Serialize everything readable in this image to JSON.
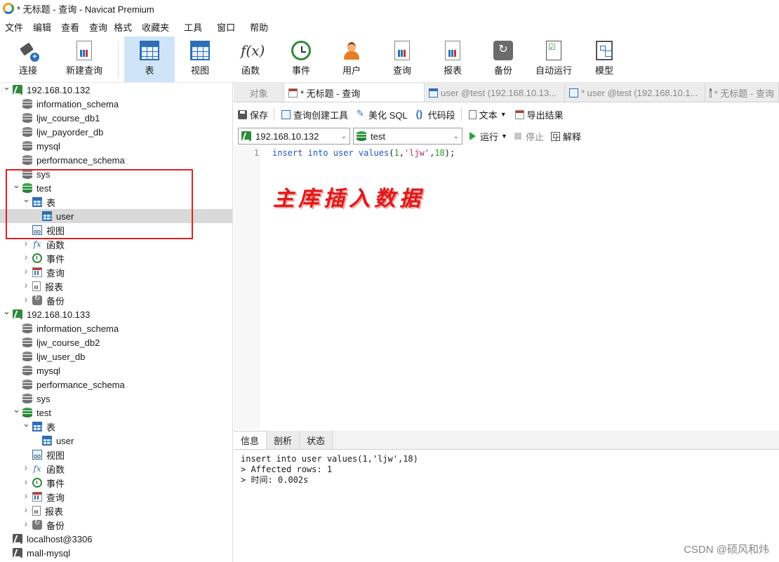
{
  "window": {
    "title": "* 无标题 - 查询 - Navicat Premium"
  },
  "menu": [
    "文件",
    "编辑",
    "查看",
    "查询",
    "格式",
    "收藏夹",
    "工具",
    "窗口",
    "帮助"
  ],
  "toolbar": {
    "connect": "连接",
    "new_query": "新建查询",
    "table": "表",
    "view": "视图",
    "function": "函数",
    "event": "事件",
    "user": "用户",
    "query": "查询",
    "report": "报表",
    "backup": "备份",
    "auto_run": "自动运行",
    "model": "模型"
  },
  "tree": {
    "server1": {
      "name": "192.168.10.132",
      "dbs": [
        "information_schema",
        "ljw_course_db1",
        "ljw_payorder_db",
        "mysql",
        "performance_schema",
        "sys"
      ],
      "test_db": "test",
      "tables_node": "表",
      "table_user": "user",
      "view_node": "视图",
      "func_node": "函数",
      "event_node": "事件",
      "query_node": "查询",
      "report_node": "报表",
      "backup_node": "备份"
    },
    "server2": {
      "name": "192.168.10.133",
      "dbs": [
        "information_schema",
        "ljw_course_db2",
        "ljw_user_db",
        "mysql",
        "performance_schema",
        "sys"
      ],
      "test_db": "test",
      "tables_node": "表",
      "table_user": "user",
      "view_node": "视图",
      "func_node": "函数",
      "event_node": "事件",
      "query_node": "查询",
      "report_node": "报表",
      "backup_node": "备份"
    },
    "server3": {
      "name": "localhost@3306"
    },
    "server4": {
      "name": "mall-mysql"
    }
  },
  "tabs": {
    "objects": "对象",
    "active": "* 无标题 - 查询",
    "tab2": "user @test (192.168.10.13...",
    "tab3": "* user @test (192.168.10.1...",
    "tab4": "* 无标题 - 查询"
  },
  "query_toolbar": {
    "save": "保存",
    "builder": "查询创建工具",
    "beautify": "美化 SQL",
    "snippet": "代码段",
    "text": "文本",
    "export": "导出结果"
  },
  "selectors": {
    "connection": "192.168.10.132",
    "database": "test",
    "run": "运行",
    "stop": "停止",
    "explain": "解释"
  },
  "editor": {
    "line_number": "1",
    "kw1": "insert",
    "kw2": "into",
    "table": "user",
    "kw3": "values",
    "p_open": "(",
    "n1": "1",
    "comma1": ",",
    "s1": "'ljw'",
    "comma2": ",",
    "n2": "18",
    "p_close": ");",
    "annotation": "主库插入数据"
  },
  "result_tabs": [
    "信息",
    "剖析",
    "状态"
  ],
  "output": {
    "line1": "insert into user values(1,'ljw',18)",
    "line2": "> Affected rows: 1",
    "line3": "> 时间: 0.002s"
  },
  "watermark": "CSDN @硕风和炜"
}
